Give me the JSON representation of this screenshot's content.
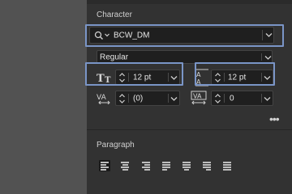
{
  "character": {
    "section_title": "Character",
    "font_family": "BCW_DM",
    "font_style": "Regular",
    "font_size": "12 pt",
    "leading": "12 pt",
    "kerning": "(0)",
    "tracking": "0"
  },
  "paragraph": {
    "section_title": "Paragraph"
  },
  "colors": {
    "panel_bg": "#323232",
    "field_bg": "#1f1f1f",
    "highlight": "#7a95c7"
  },
  "icons": [
    "search-icon",
    "font-size-icon",
    "leading-icon",
    "kerning-icon",
    "tracking-icon",
    "chevron-down-icon",
    "stepper-icon",
    "more-options-icon",
    "align-left-icon",
    "align-center-icon",
    "align-right-icon",
    "justify-last-left-icon",
    "justify-last-center-icon",
    "justify-last-right-icon",
    "justify-all-icon"
  ]
}
